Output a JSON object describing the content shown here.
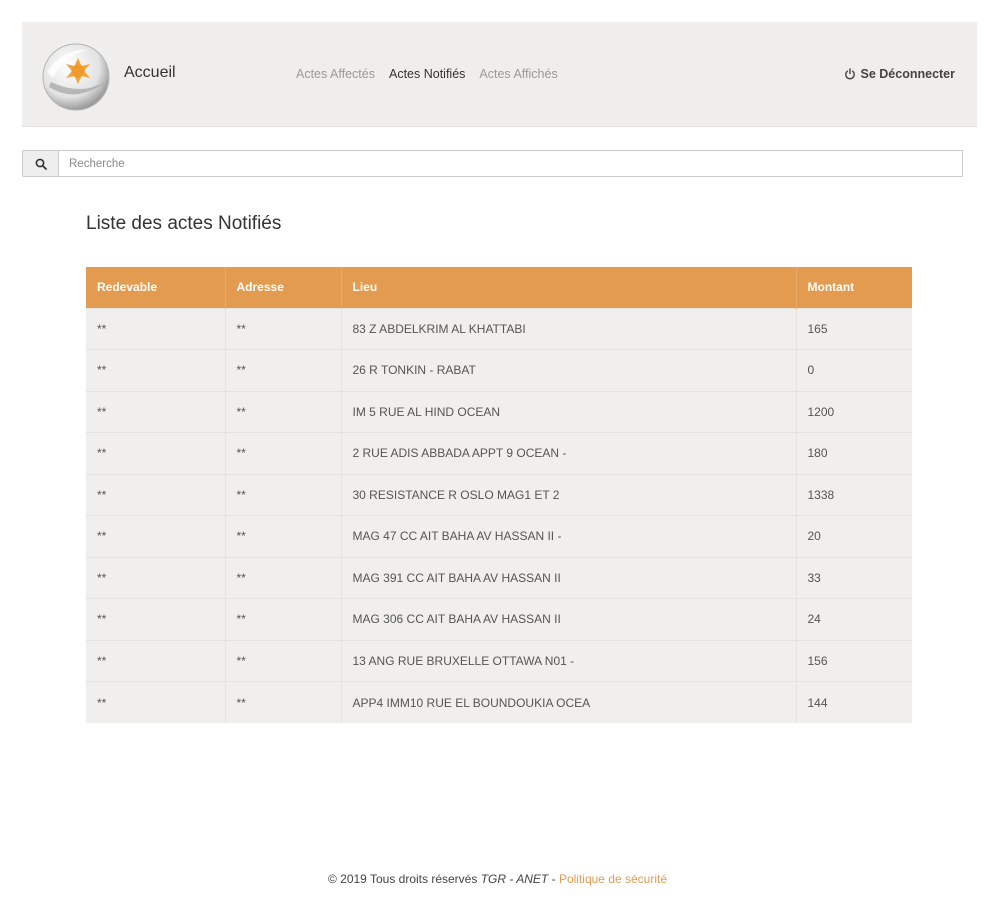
{
  "header": {
    "brand": "Accueil",
    "nav": [
      {
        "label": "Actes Affectés",
        "active": false
      },
      {
        "label": "Actes Notifiés",
        "active": true
      },
      {
        "label": "Actes Affichés",
        "active": false
      }
    ],
    "logout_label": "Se Déconnecter"
  },
  "search": {
    "placeholder": "Recherche",
    "value": ""
  },
  "main": {
    "title": "Liste des actes Notifiés",
    "table": {
      "headers": [
        "Redevable",
        "Adresse",
        "Lieu",
        "Montant"
      ],
      "rows": [
        [
          "**",
          "**",
          "83 Z ABDELKRIM AL KHATTABI",
          "165"
        ],
        [
          "**",
          "**",
          "26 R TONKIN - RABAT",
          "0"
        ],
        [
          "**",
          "**",
          "IM 5 RUE AL HIND OCEAN",
          "1200"
        ],
        [
          "**",
          "**",
          "2 RUE ADIS ABBADA APPT 9 OCEAN -",
          "180"
        ],
        [
          "**",
          "**",
          "30 RESISTANCE R OSLO MAG1 ET 2",
          "1338"
        ],
        [
          "**",
          "**",
          "MAG 47 CC AIT BAHA AV HASSAN II -",
          "20"
        ],
        [
          "**",
          "**",
          "MAG 391 CC AIT BAHA AV HASSAN II",
          "33"
        ],
        [
          "**",
          "**",
          "MAG 306 CC AIT BAHA AV HASSAN II",
          "24"
        ],
        [
          "**",
          "**",
          "13 ANG RUE BRUXELLE OTTAWA N01 -",
          "156"
        ],
        [
          "**",
          "**",
          "APP4 IMM10 RUE EL BOUNDOUKIA OCEA",
          "144"
        ]
      ]
    }
  },
  "footer": {
    "copyright": "© 2019 Tous droits réservés",
    "brand": "TGR - ANET",
    "separator": " - ",
    "policy_link": "Politique de sécurité"
  },
  "colors": {
    "accent": "#e39b4f",
    "header_bg": "#efeeec",
    "row_bg": "#f0efed"
  },
  "icons": {
    "logo": "sun-badge-logo",
    "logout": "power-icon",
    "search": "search-icon"
  }
}
